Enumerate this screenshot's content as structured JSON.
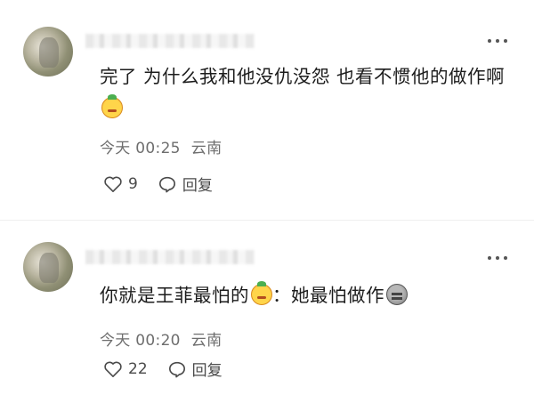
{
  "comments": [
    {
      "text_before_emoji": "完了 为什么我和他没仇没怨 也看不惯他的做作啊",
      "emoji": "smirk-emoji",
      "text_after_emoji": "",
      "time": "今天 00:25",
      "location": "云南",
      "like_count": "9",
      "reply_label": "回复"
    },
    {
      "text_before_emoji": "你就是王菲最怕的",
      "emoji": "smirk-emoji",
      "text_after_emoji": "：她最怕做作",
      "emoji2": "rock-emoji",
      "time": "今天 00:20",
      "location": "云南",
      "like_count": "22",
      "reply_label": "回复"
    }
  ],
  "colors": {
    "text": "#1c1c1c",
    "meta": "#6e6e6e",
    "icon": "#4a4a4a"
  }
}
